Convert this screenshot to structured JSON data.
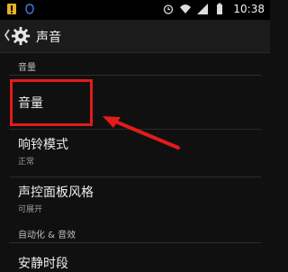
{
  "status_bar": {
    "time": "10:38"
  },
  "action_bar": {
    "title": "声音"
  },
  "sections": {
    "volume_header": "音量",
    "automation_header": "自动化 & 音效"
  },
  "items": {
    "volume": {
      "label": "音量"
    },
    "ringer_mode": {
      "label": "响铃模式",
      "value": "正常"
    },
    "control_panel": {
      "label": "声控面板风格",
      "value": "可展开"
    },
    "quiet_hours": {
      "label": "安静时段"
    }
  },
  "colors": {
    "annotation_red": "#e41b1b",
    "background": "#101010"
  }
}
